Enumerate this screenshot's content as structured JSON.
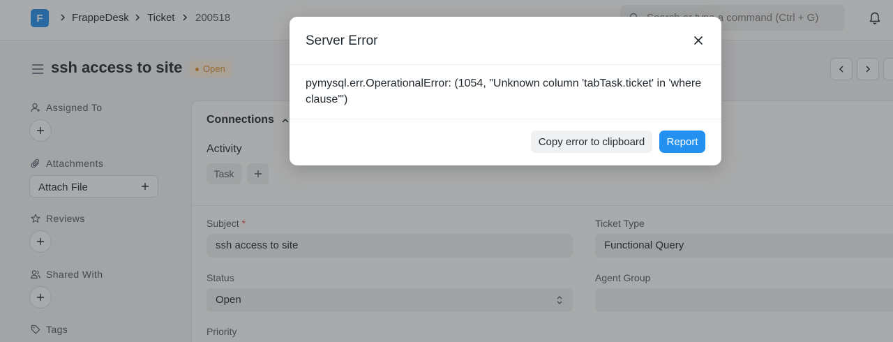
{
  "navbar": {
    "logo_letter": "F",
    "breadcrumbs": [
      "FrappeDesk",
      "Ticket",
      "200518"
    ],
    "search_placeholder": "Search or type a command (Ctrl + G)"
  },
  "page": {
    "title": "ssh access to site",
    "status": "Open"
  },
  "sidebar": {
    "assigned_to": "Assigned To",
    "attachments": "Attachments",
    "attach_file": "Attach File",
    "reviews": "Reviews",
    "shared_with": "Shared With",
    "tags": "Tags"
  },
  "main": {
    "connections": "Connections",
    "activity": "Activity",
    "task_chip": "Task",
    "fields": {
      "subject_label": "Subject",
      "subject_required": "*",
      "subject_value": "ssh access to site",
      "ticket_type_label": "Ticket Type",
      "ticket_type_value": "Functional Query",
      "status_label": "Status",
      "status_value": "Open",
      "agent_group_label": "Agent Group",
      "agent_group_value": "",
      "priority_label": "Priority"
    }
  },
  "modal": {
    "title": "Server Error",
    "message": "pymysql.err.OperationalError: (1054, \"Unknown column 'tabTask.ticket' in 'where clause'\")",
    "copy_button": "Copy error to clipboard",
    "report_button": "Report"
  },
  "colors": {
    "primary": "#2490ef",
    "status_open": "#e0922e"
  }
}
